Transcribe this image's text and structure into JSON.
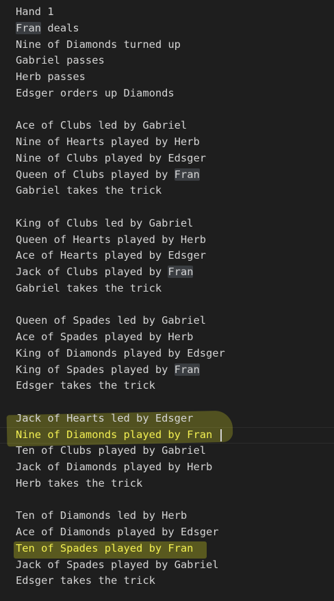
{
  "editor": {
    "lines": {
      "l01": "Hand 1",
      "l02_name": "Fran",
      "l02_rest": " deals",
      "l03": "Nine of Diamonds turned up",
      "l04": "Gabriel passes",
      "l05": "Herb passes",
      "l06": "Edsger orders up Diamonds",
      "l08": "Ace of Clubs led by Gabriel",
      "l09": "Nine of Hearts played by Herb",
      "l10": "Nine of Clubs played by Edsger",
      "l11_text": "Queen of Clubs played by ",
      "l11_name": "Fran",
      "l12": "Gabriel takes the trick",
      "l14": "King of Clubs led by Gabriel",
      "l15": "Queen of Hearts played by Herb",
      "l16": "Ace of Hearts played by Edsger",
      "l17_text": "Jack of Clubs played by ",
      "l17_name": "Fran",
      "l18": "Gabriel takes the trick",
      "l20": "Queen of Spades led by Gabriel",
      "l21": "Ace of Spades played by Herb",
      "l22": "King of Diamonds played by Edsger",
      "l23_text": "King of Spades played by ",
      "l23_name": "Fran",
      "l24": "Edsger takes the trick",
      "l26": "Jack of Hearts led by Edsger",
      "l27": "Nine of Diamonds played by Fran",
      "l28": "Ten of Clubs played by Gabriel",
      "l29": "Jack of Diamonds played by Herb",
      "l30": "Herb takes the trick",
      "l32": "Ten of Diamonds led by Herb",
      "l33": "Ace of Diamonds played by Edsger",
      "l34": "Ten of Spades played by Fran",
      "l35": "Jack of Spades played by Gabriel",
      "l36": "Edsger takes the trick"
    },
    "colors": {
      "background": "#1e1e1e",
      "text": "#d4d4d4",
      "word_highlight": "#3a3d41",
      "marker": "#e4e426"
    }
  }
}
